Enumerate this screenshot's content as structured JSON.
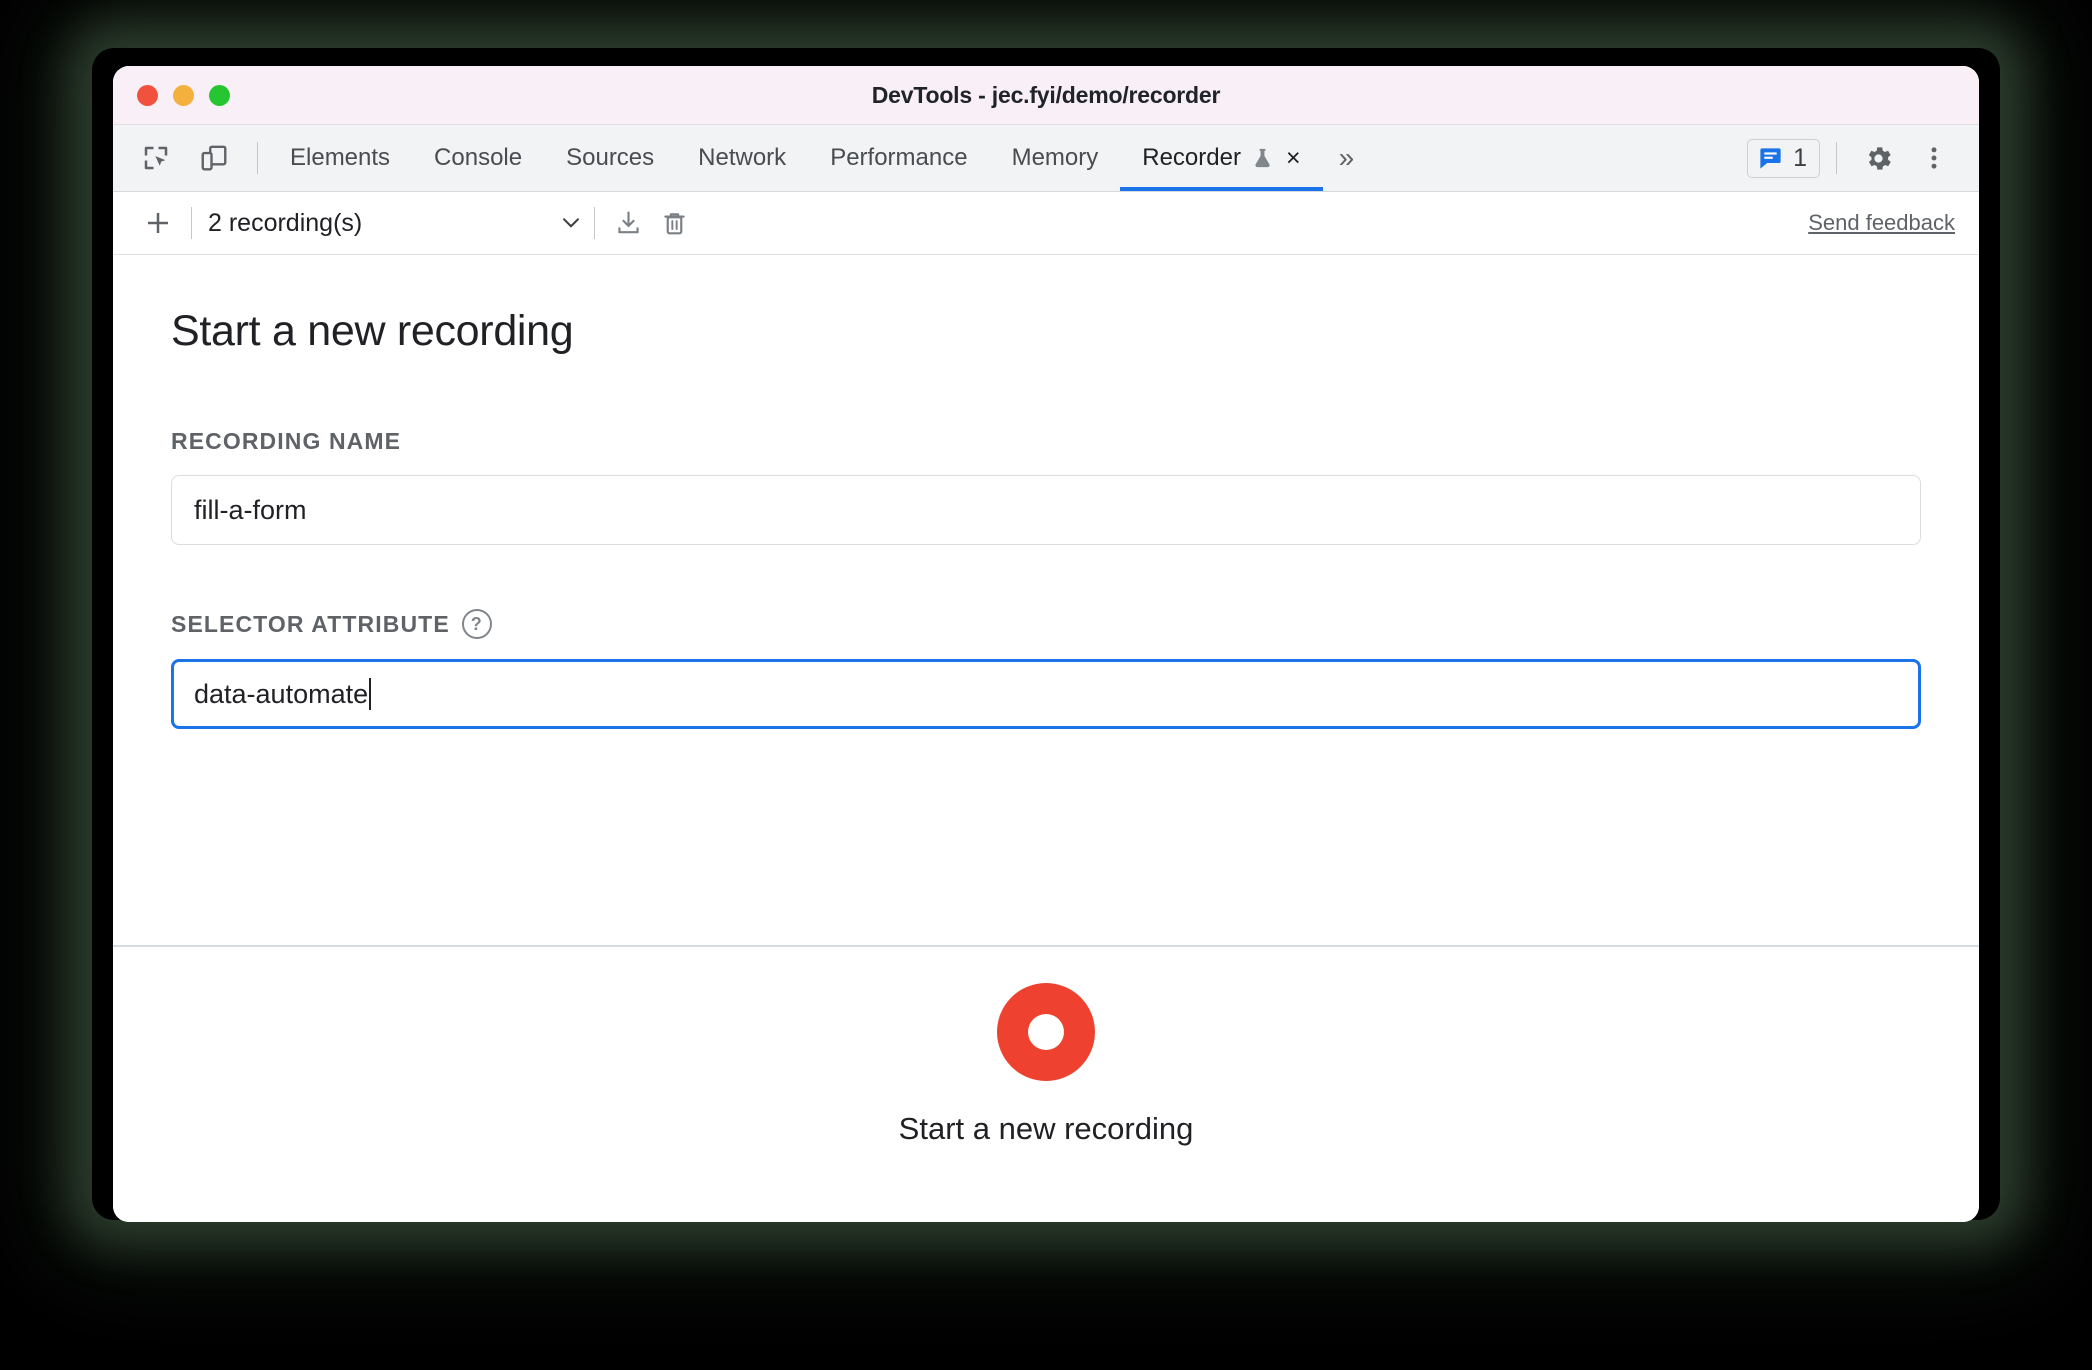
{
  "window": {
    "title": "DevTools - jec.fyi/demo/recorder",
    "traffic_lights": [
      "close-red",
      "minimize-yellow",
      "maximize-green"
    ]
  },
  "tabstrip": {
    "left_tools": [
      {
        "name": "inspect-element-icon",
        "label": "Inspect element"
      },
      {
        "name": "device-toolbar-icon",
        "label": "Toggle device toolbar"
      }
    ],
    "tabs": [
      {
        "label": "Elements",
        "active": false
      },
      {
        "label": "Console",
        "active": false
      },
      {
        "label": "Sources",
        "active": false
      },
      {
        "label": "Network",
        "active": false
      },
      {
        "label": "Performance",
        "active": false
      },
      {
        "label": "Memory",
        "active": false
      },
      {
        "label": "Recorder",
        "active": true,
        "experimental": true,
        "closable": true
      }
    ],
    "overflow_label": "»",
    "close_label": "×",
    "issues": {
      "count": "1",
      "icon": "issues-message-icon"
    },
    "settings_icon": "gear-icon",
    "more_icon": "kebab-menu-icon",
    "accent_color": "#1a73e8"
  },
  "recorder_toolbar": {
    "add_label": "+",
    "recordings_label": "2 recording(s)",
    "chevron": "chevron-down-icon",
    "import_icon": "download-icon",
    "delete_icon": "trash-icon",
    "feedback_label": "Send feedback"
  },
  "main": {
    "title": "Start a new recording",
    "fields": [
      {
        "label": "RECORDING NAME",
        "value": "fill-a-form",
        "placeholder": "Recording name",
        "focused": false,
        "has_help": false
      },
      {
        "label": "SELECTOR ATTRIBUTE",
        "value": "data-automate",
        "placeholder": "Selector attribute",
        "focused": true,
        "has_help": true,
        "help_glyph": "?"
      }
    ]
  },
  "footer": {
    "record_button_label": "Start a new recording",
    "record_button_color": "#ef4130",
    "record_icon": "record-circle-icon"
  }
}
